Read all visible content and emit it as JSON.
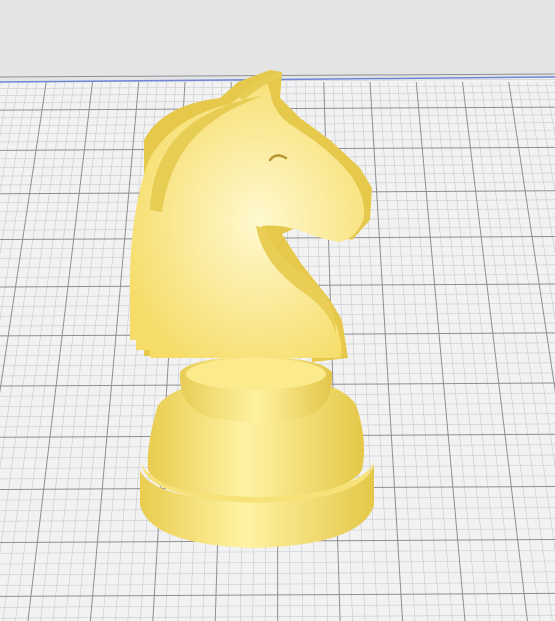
{
  "viewport": {
    "background_color": "#e6e6e6",
    "bed_color": "#f1f1f2",
    "grid_major_color": "#8d8f94",
    "grid_minor_color": "#c9cace",
    "bed_edge_color": "#6f86d8"
  },
  "model": {
    "object": "knight-chess-piece",
    "color": "#f9e57a",
    "shadow_color": "#e3c548",
    "highlight_color": "#fff6b8"
  }
}
